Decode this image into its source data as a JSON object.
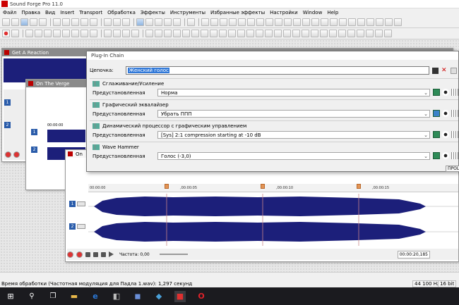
{
  "app": {
    "title": "Sound Forge Pro 11.0"
  },
  "menu": [
    "Файл",
    "Правка",
    "Вид",
    "Insert",
    "Transport",
    "Обработка",
    "Эффекты",
    "Инструменты",
    "Избранные эффекты",
    "Настройки",
    "Window",
    "Help"
  ],
  "windows": {
    "win1_title": "Get A Reaction",
    "win2_title": "On The Verge",
    "win2_time": "00:00:00",
    "win3_title": "On",
    "ruler_ticks": [
      "00:00:00",
      ",00:00:05",
      ",00:00:10",
      ",00:00:15"
    ],
    "channels": [
      "1",
      "2"
    ],
    "rate_label": "Частота: 0,00",
    "time_readout": "00:00:20,185"
  },
  "plugin": {
    "title": "Plug-In Chain",
    "chain_label": "Цепочка:",
    "chain_value": "Женский голос",
    "preset_label": "Предустановленная",
    "effects": [
      {
        "name": "Сглаживание/Усиление",
        "preset": "Норма"
      },
      {
        "name": "Графический эквалайзер",
        "preset": "Убрать ППП"
      },
      {
        "name": "Динамический процессор с графическим управлением",
        "preset": "[Sys] 2:1 compression starting at -10 dB"
      },
      {
        "name": "Wave Hammer",
        "preset": "Голос (-3,0)"
      }
    ],
    "process_label": "ПРОЦ"
  },
  "status": {
    "text": "Время обработки (Частотная модуляция для Падла 1.wav): 1,297 секунд",
    "sample_rate": "44 100 Hz",
    "bit_depth": "16 bit"
  },
  "taskbar": [
    "start-icon",
    "search-icon",
    "taskview-icon",
    "explorer-icon",
    "edge-icon",
    "store-icon",
    "save-icon",
    "folder-icon",
    "soundforge-icon",
    "opera-icon"
  ]
}
